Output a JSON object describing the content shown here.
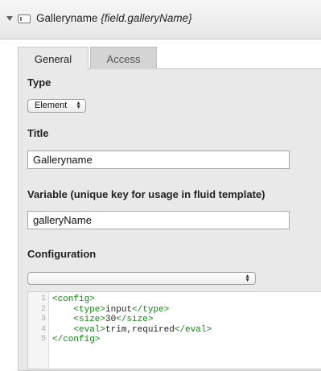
{
  "header": {
    "title": "Galleryname",
    "hint": "{field.galleryName}"
  },
  "tabs": [
    {
      "label": "General",
      "active": true
    },
    {
      "label": "Access",
      "active": false
    }
  ],
  "form": {
    "type": {
      "label": "Type",
      "value": "Element"
    },
    "title": {
      "label": "Title",
      "value": "Galleryname"
    },
    "variable": {
      "label": "Variable (unique key for usage in fluid template)",
      "value": "galleryName"
    },
    "configuration": {
      "label": "Configuration",
      "select_value": ""
    }
  },
  "code": {
    "lines": [
      {
        "number": "1",
        "indent": "",
        "open": "<config>",
        "text": "",
        "close": ""
      },
      {
        "number": "2",
        "indent": "    ",
        "open": "<type>",
        "text": "input",
        "close": "</type>"
      },
      {
        "number": "3",
        "indent": "    ",
        "open": "<size>",
        "text": "30",
        "close": "</size>"
      },
      {
        "number": "4",
        "indent": "    ",
        "open": "<eval>",
        "text": "trim,required",
        "close": "</eval>"
      },
      {
        "number": "5",
        "indent": "",
        "open": "</config>",
        "text": "",
        "close": ""
      }
    ]
  },
  "colors": {
    "tag": "#118811",
    "line_number": "#aaaaaa"
  },
  "icons": {
    "collapse": "chevron-down-icon",
    "field": "input-field-icon",
    "select": "updown-arrows-icon"
  }
}
